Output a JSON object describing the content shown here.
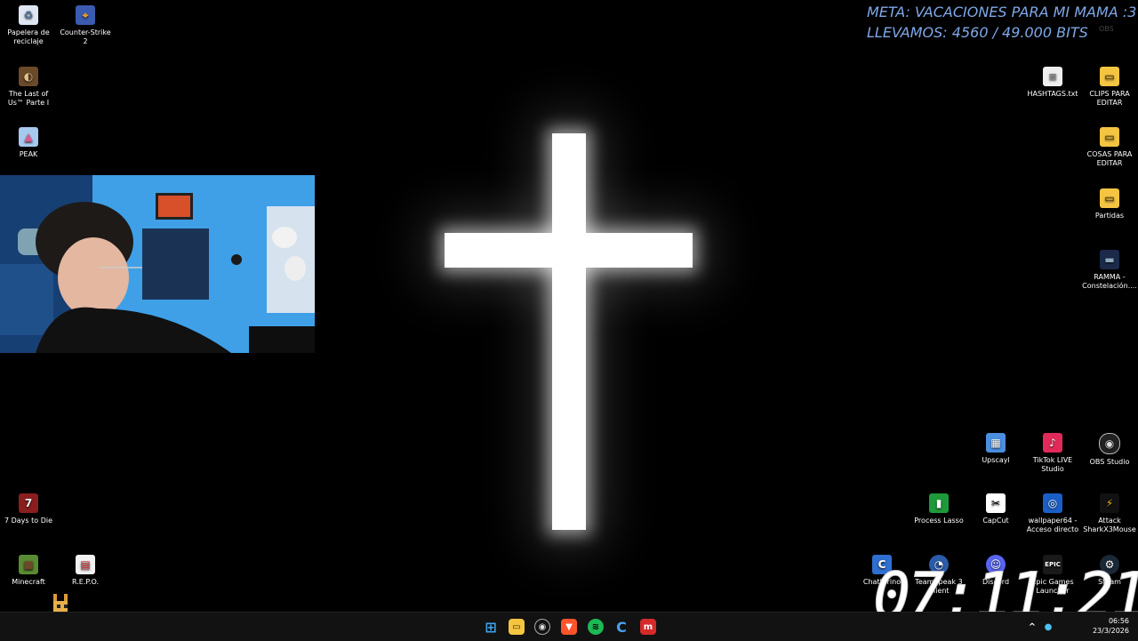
{
  "overlay": {
    "goal_line": "META: VACACIONES PARA MI MAMA :3",
    "progress_line": "LLEVAMOS: 4560 / 49.000 BITS",
    "obs_faint": "OBS",
    "big_clock": "07:11:21"
  },
  "desktop_icons": {
    "recycle_bin": "Papelera de reciclaje",
    "cs2": "Counter-Strike 2",
    "tlou": "The Last of Us™ Parte I",
    "peak": "PEAK",
    "hashtags": "HASHTAGS.txt",
    "clips": "CLIPS PARA EDITAR",
    "cosas": "COSAS PARA EDITAR",
    "partidas": "Partidas",
    "ramma": "RAMMA - Constelación....",
    "upscayl": "Upscayl",
    "tiktok": "TikTok LIVE Studio",
    "obs": "OBS Studio",
    "process_lasso": "Process Lasso",
    "capcut": "CapCut",
    "wallpaper64": "wallpaper64 - Acceso directo",
    "attack_shark": "Attack SharkX3Mouse",
    "chatterino": "Chatterino",
    "teamspeak": "TeamSpeak 3 Client",
    "discord": "Discord",
    "epic": "Epic Games Launcher",
    "steam": "Steam",
    "days7": "7 Days to Die",
    "minecraft": "Minecraft",
    "repo": "R.E.P.O."
  },
  "taskbar": {
    "time": "06:56",
    "date": "23/3/2026"
  },
  "colors": {
    "overlay_text": "#7fa8e8",
    "taskbar_bg": "#121212",
    "spotify": "#1db954",
    "brave": "#fb542b"
  }
}
